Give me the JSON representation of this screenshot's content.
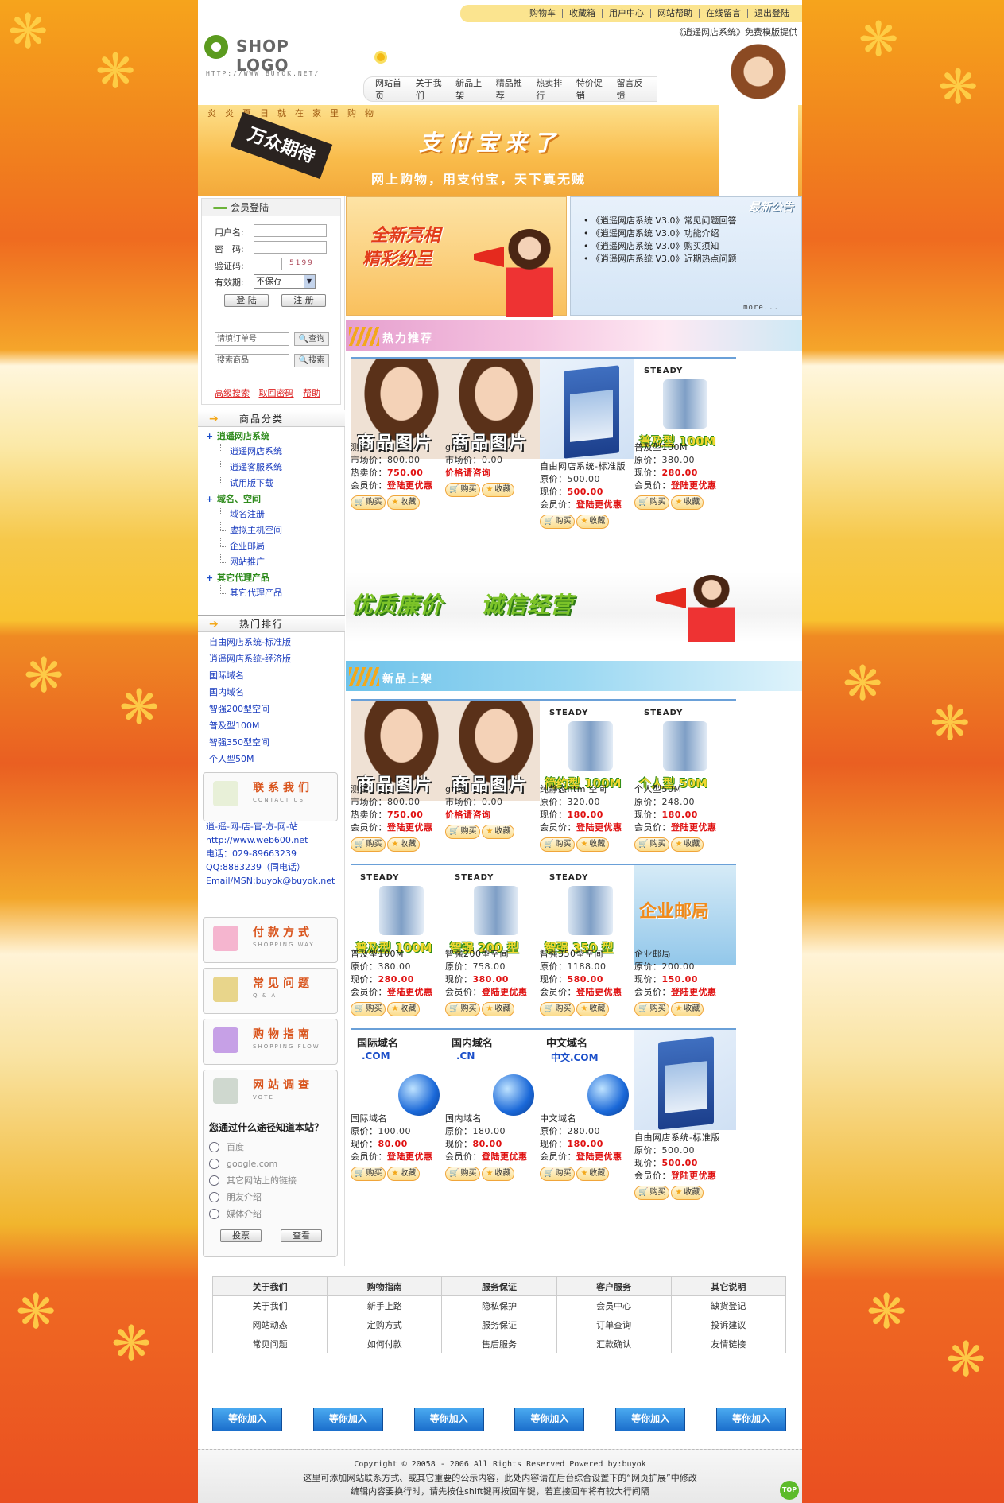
{
  "top_links": [
    "购物车",
    "收藏箱",
    "用户中心",
    "网站帮助",
    "在线留言",
    "退出登陆"
  ],
  "logo": {
    "text": "SHOP LOGO",
    "url": "HTTP://WWW.BUYOK.NET/"
  },
  "marquee": "《逍遥网店系统》免费模版提供",
  "main_nav": [
    "网站首页",
    "关于我们",
    "新品上架",
    "精品推荐",
    "热卖排行",
    "特价促销",
    "留言反馈"
  ],
  "banner": {
    "slogan": "炎炎夏日就在家里购物",
    "badge": "万众期待",
    "headline": "支付宝来了",
    "sub": "网上购物，用支付宝，天下真无贼"
  },
  "login": {
    "title": "会员登陆",
    "username_label": "用户名:",
    "password_label": "密　码:",
    "code_label": "验证码:",
    "captcha": "5199",
    "expiry_label": "有效期:",
    "expiry_value": "不保存",
    "login_btn": "登 陆",
    "register_btn": "注 册",
    "order_placeholder": "请填订单号",
    "order_btn": "查询",
    "product_placeholder": "搜索商品",
    "product_btn": "搜索",
    "links": [
      "高级搜索",
      "取回密码",
      "帮助"
    ]
  },
  "categories": {
    "title": "商品分类",
    "groups": [
      {
        "name": "逍遥网店系统",
        "items": [
          "逍遥网店系统",
          "逍遥客服系统",
          "试用版下载"
        ]
      },
      {
        "name": "域名、空间",
        "items": [
          "域名注册",
          "虚拟主机空间",
          "企业邮局",
          "网站推广"
        ]
      },
      {
        "name": "其它代理产品",
        "items": [
          "其它代理产品"
        ]
      }
    ]
  },
  "hot_rank": {
    "title": "热门排行",
    "items": [
      "自由网店系统-标准版",
      "逍遥网店系统-经济版",
      "国际域名",
      "国内域名",
      "智强200型空间",
      "普及型100M",
      "智强350型空间",
      "个人型50M"
    ]
  },
  "contact": {
    "title": "联系我们",
    "en": "CONTACT US",
    "lines": [
      "逍-遥-网-店-官-方-网-站",
      "http://www.web600.net",
      "电话：029-89663239",
      "QQ:8883239（同电话）",
      "Email/MSN:buyok@buyok.net"
    ]
  },
  "boxes": [
    {
      "title": "付款方式",
      "en": "SHOPPING WAY"
    },
    {
      "title": "常见问题",
      "en": "Q & A"
    },
    {
      "title": "购物指南",
      "en": "SHOPPING FLOW"
    },
    {
      "title": "网站调查",
      "en": "VOTE"
    }
  ],
  "vote": {
    "question": "您通过什么途径知道本站？",
    "options": [
      "百度",
      "google.com",
      "其它网站上的链接",
      "朋友介绍",
      "媒体介绍"
    ],
    "vote_btn": "投票",
    "view_btn": "查看"
  },
  "promo": {
    "line1": "全新亮相",
    "line2": "精彩纷呈"
  },
  "notice": {
    "title": "最新公告",
    "items": [
      "《逍遥网店系统 V3.0》常见问题回答",
      "《逍遥网店系统 V3.0》功能介绍",
      "《逍遥网店系统 V3.0》购买须知",
      "《逍遥网店系统 V3.0》近期热点问题"
    ],
    "more": "more..."
  },
  "hot_title": "热力推荐",
  "new_title": "新品上架",
  "mid_banner": {
    "left": "优质廉价",
    "right": "诚信经营"
  },
  "actions": {
    "buy": "购买",
    "fav": "收藏"
  },
  "hot_products": [
    {
      "img": "photo",
      "cap": "商品图片",
      "name": "测试",
      "lines": [
        {
          "label": "市场价：",
          "value": "800.00",
          "red": false
        },
        {
          "label": "热卖价：",
          "value": "750.00",
          "red": true
        },
        {
          "label": "会员价：",
          "value": "登陆更优惠",
          "red": true
        }
      ]
    },
    {
      "img": "photo",
      "cap": "商品图片",
      "name": "gfdg",
      "lines": [
        {
          "label": "市场价：",
          "value": "0.00",
          "red": false
        },
        {
          "label": "",
          "value": "价格请咨询",
          "red": true
        }
      ]
    },
    {
      "img": "box",
      "name": "自由网店系统-标准版",
      "lines": [
        {
          "label": "原价：",
          "value": "500.00",
          "red": false
        },
        {
          "label": "现价：",
          "value": "500.00",
          "red": true
        },
        {
          "label": "会员价：",
          "value": "登陆更优惠",
          "red": true
        }
      ]
    },
    {
      "img": "srv",
      "logo": "STEADY",
      "cap": "普及型 100M",
      "name": "普及型100M",
      "lines": [
        {
          "label": "原价：",
          "value": "380.00",
          "red": false
        },
        {
          "label": "现价：",
          "value": "280.00",
          "red": true
        },
        {
          "label": "会员价：",
          "value": "登陆更优惠",
          "red": true
        }
      ]
    }
  ],
  "new_products": [
    {
      "img": "photo",
      "cap": "商品图片",
      "name": "测试",
      "lines": [
        {
          "label": "市场价：",
          "value": "800.00",
          "red": false
        },
        {
          "label": "热卖价：",
          "value": "750.00",
          "red": true
        },
        {
          "label": "会员价：",
          "value": "登陆更优惠",
          "red": true
        }
      ]
    },
    {
      "img": "photo",
      "cap": "商品图片",
      "name": "gfdg",
      "lines": [
        {
          "label": "市场价：",
          "value": "0.00",
          "red": false
        },
        {
          "label": "",
          "value": "价格请咨询",
          "red": true
        }
      ]
    },
    {
      "img": "srv",
      "logo": "STEADY",
      "cap": "简约型 100M",
      "name": "纯静态html空间",
      "lines": [
        {
          "label": "原价：",
          "value": "320.00",
          "red": false
        },
        {
          "label": "现价：",
          "value": "180.00",
          "red": true
        },
        {
          "label": "会员价：",
          "value": "登陆更优惠",
          "red": true
        }
      ]
    },
    {
      "img": "srv",
      "logo": "STEADY",
      "cap": "个人型 50M",
      "name": "个人型50M",
      "lines": [
        {
          "label": "原价：",
          "value": "248.00",
          "red": false
        },
        {
          "label": "现价：",
          "value": "180.00",
          "red": true
        },
        {
          "label": "会员价：",
          "value": "登陆更优惠",
          "red": true
        }
      ]
    },
    {
      "img": "srv",
      "logo": "STEADY",
      "cap": "普及型 100M",
      "name": "普及型100M",
      "lines": [
        {
          "label": "原价：",
          "value": "380.00",
          "red": false
        },
        {
          "label": "现价：",
          "value": "280.00",
          "red": true
        },
        {
          "label": "会员价：",
          "value": "登陆更优惠",
          "red": true
        }
      ]
    },
    {
      "img": "srv",
      "logo": "STEADY",
      "cap": "智强 200 型",
      "name": "智强200型空间",
      "lines": [
        {
          "label": "原价：",
          "value": "758.00",
          "red": false
        },
        {
          "label": "现价：",
          "value": "380.00",
          "red": true
        },
        {
          "label": "会员价：",
          "value": "登陆更优惠",
          "red": true
        }
      ]
    },
    {
      "img": "srv",
      "logo": "STEADY",
      "cap": "智强 350 型",
      "name": "智强350型空间",
      "lines": [
        {
          "label": "原价：",
          "value": "1188.00",
          "red": false
        },
        {
          "label": "现价：",
          "value": "580.00",
          "red": true
        },
        {
          "label": "会员价：",
          "value": "登陆更优惠",
          "red": true
        }
      ]
    },
    {
      "img": "mail",
      "cap": "企业邮局",
      "name": "企业邮局",
      "lines": [
        {
          "label": "原价：",
          "value": "200.00",
          "red": false
        },
        {
          "label": "现价：",
          "value": "150.00",
          "red": true
        },
        {
          "label": "会员价：",
          "value": "登陆更优惠",
          "red": true
        }
      ]
    },
    {
      "img": "dom",
      "dt": "国际域名",
      "dx": ".COM",
      "name": "国际域名",
      "lines": [
        {
          "label": "原价：",
          "value": "100.00",
          "red": false
        },
        {
          "label": "现价：",
          "value": "80.00",
          "red": true
        },
        {
          "label": "会员价：",
          "value": "登陆更优惠",
          "red": true
        }
      ]
    },
    {
      "img": "dom",
      "dt": "国内域名",
      "dx": ".CN",
      "name": "国内域名",
      "lines": [
        {
          "label": "原价：",
          "value": "180.00",
          "red": false
        },
        {
          "label": "现价：",
          "value": "80.00",
          "red": true
        },
        {
          "label": "会员价：",
          "value": "登陆更优惠",
          "red": true
        }
      ]
    },
    {
      "img": "dom",
      "dt": "中文域名",
      "dx": "中文.COM",
      "name": "中文域名",
      "lines": [
        {
          "label": "原价：",
          "value": "280.00",
          "red": false
        },
        {
          "label": "现价：",
          "value": "180.00",
          "red": true
        },
        {
          "label": "会员价：",
          "value": "登陆更优惠",
          "red": true
        }
      ]
    },
    {
      "img": "box",
      "name": "自由网店系统-标准版",
      "lines": [
        {
          "label": "原价：",
          "value": "500.00",
          "red": false
        },
        {
          "label": "现价：",
          "value": "500.00",
          "red": true
        },
        {
          "label": "会员价：",
          "value": "登陆更优惠",
          "red": true
        }
      ]
    }
  ],
  "footer": {
    "headers": [
      "关于我们",
      "购物指南",
      "服务保证",
      "客户服务",
      "其它说明"
    ],
    "rows": [
      [
        "关于我们",
        "新手上路",
        "隐私保护",
        "会员中心",
        "缺货登记"
      ],
      [
        "网站动态",
        "定购方式",
        "服务保证",
        "订单查询",
        "投诉建议"
      ],
      [
        "常见问题",
        "如何付款",
        "售后服务",
        "汇款确认",
        "友情链接"
      ]
    ],
    "link_label": "等你加入",
    "copyright": "Copyright © 20058 - 2006    All Rights Reserved    Powered by:buyok",
    "note1": "这里可添加网站联系方式、或其它重要的公示内容，此处内容请在后台综合设置下的“网页扩展”中修改",
    "note2": "编辑内容要换行时，请先按住shift键再按回车键，若直接回车将有较大行间隔",
    "top": "TOP"
  },
  "colors": {
    "accent": "#f3a81b",
    "red": "#e01010",
    "link": "#1a3cbf",
    "green": "#2e8b1c"
  }
}
